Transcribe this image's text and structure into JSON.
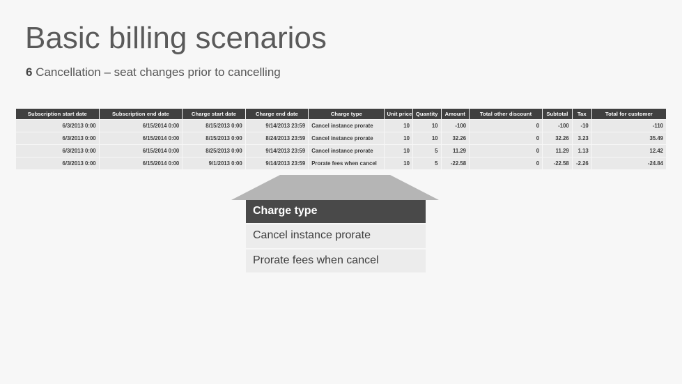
{
  "slide": {
    "title": "Basic billing scenarios",
    "subtitle_number": "6",
    "subtitle_text": " Cancellation – seat changes prior to cancelling",
    "background_color": "#f7f7f7",
    "accent_dark": "#404040",
    "row_color": "#e9e9e9"
  },
  "table": {
    "headers": [
      "Subscription start date",
      "Subscription end date",
      "Charge start date",
      "Charge end date",
      "Charge type",
      "Unit price",
      "Quantity",
      "Amount",
      "Total other discount",
      "Subtotal",
      "Tax",
      "Total for customer"
    ],
    "rows": [
      {
        "subscription_start_date": "6/3/2013 0:00",
        "subscription_end_date": "6/15/2014 0:00",
        "charge_start_date": "8/15/2013 0:00",
        "charge_end_date": "9/14/2013 23:59",
        "charge_type": "Cancel instance prorate",
        "unit_price": "10",
        "quantity": "10",
        "amount": "-100",
        "total_other_discount": "0",
        "subtotal": "-100",
        "tax": "-10",
        "total_for_customer": "-110"
      },
      {
        "subscription_start_date": "6/3/2013 0:00",
        "subscription_end_date": "6/15/2014 0:00",
        "charge_start_date": "8/15/2013 0:00",
        "charge_end_date": "8/24/2013 23:59",
        "charge_type": "Cancel instance prorate",
        "unit_price": "10",
        "quantity": "10",
        "amount": "32.26",
        "total_other_discount": "0",
        "subtotal": "32.26",
        "tax": "3.23",
        "total_for_customer": "35.49"
      },
      {
        "subscription_start_date": "6/3/2013 0:00",
        "subscription_end_date": "6/15/2014 0:00",
        "charge_start_date": "8/25/2013 0:00",
        "charge_end_date": "9/14/2013 23:59",
        "charge_type": "Cancel instance prorate",
        "unit_price": "10",
        "quantity": "5",
        "amount": "11.29",
        "total_other_discount": "0",
        "subtotal": "11.29",
        "tax": "1.13",
        "total_for_customer": "12.42"
      },
      {
        "subscription_start_date": "6/3/2013 0:00",
        "subscription_end_date": "6/15/2014 0:00",
        "charge_start_date": "9/1/2013 0:00",
        "charge_end_date": "9/14/2013 23:59",
        "charge_type": "Prorate fees when cancel",
        "unit_price": "10",
        "quantity": "5",
        "amount": "-22.58",
        "total_other_discount": "0",
        "subtotal": "-22.58",
        "tax": "-2.26",
        "total_for_customer": "-24.84"
      }
    ]
  },
  "callout": {
    "header": "Charge type",
    "items": [
      "Cancel instance prorate",
      "Prorate fees when cancel"
    ],
    "cone_color": "#b5b5b5"
  }
}
